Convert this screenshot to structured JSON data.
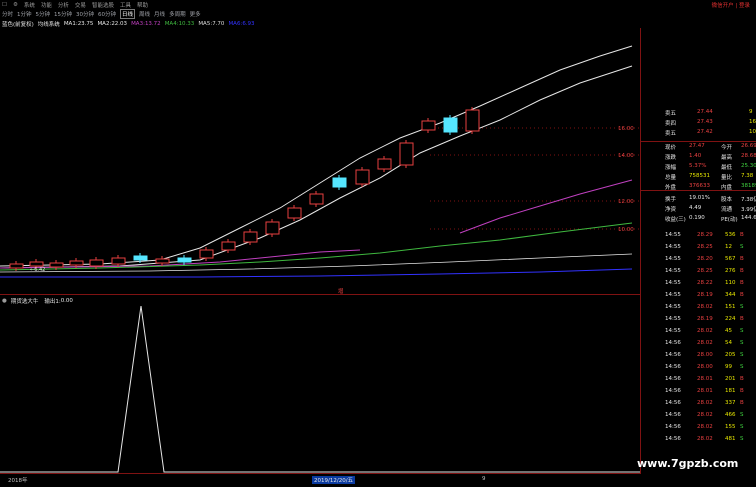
{
  "toolbar": {
    "items": [
      "☐",
      "⚙",
      "系统",
      "功能",
      "分析",
      "交易",
      "智能选股",
      "工具",
      "帮助"
    ],
    "right_text": "微信开户 | 登录"
  },
  "periods": {
    "items": [
      "分时",
      "1分钟",
      "5分钟",
      "15分钟",
      "30分钟",
      "60分钟",
      "日线",
      "周线",
      "月线",
      "多周期",
      "更多"
    ],
    "active": "日线"
  },
  "ma_legend": {
    "title": "蓝色(前复权)",
    "formula": "均线系统",
    "items": [
      {
        "label": "MA1:",
        "value": "23.75",
        "color": "#e6e6e6"
      },
      {
        "label": "MA2:",
        "value": "22.03",
        "color": "#e6e6e6"
      },
      {
        "label": "MA3:",
        "value": "13.72",
        "color": "#c040c0"
      },
      {
        "label": "MA4:",
        "value": "10.33",
        "color": "#3fb83f"
      },
      {
        "label": "MA5:",
        "value": "7.70",
        "color": "#dcdcdc"
      },
      {
        "label": "MA6:",
        "value": "6.93",
        "color": "#3232ff"
      }
    ]
  },
  "price_axis": {
    "labels": [
      "16.00",
      "14.00",
      "12.00",
      "10.00"
    ]
  },
  "chart_annotation": "增",
  "low_label": "←6.42",
  "indicator_legend": {
    "name": "期货选大牛",
    "output_label": "输出1:",
    "output_value": "0.00"
  },
  "quote": {
    "rows": [
      {
        "label": "卖五",
        "value": "27.44",
        "right": "9",
        "vcolor": "#e84040",
        "rcolor": "#e8e800"
      },
      {
        "label": "卖四",
        "value": "27.43",
        "right": "16",
        "vcolor": "#e84040",
        "rcolor": "#e8e800"
      },
      {
        "label": "卖五",
        "value": "27.42",
        "right": "10",
        "vcolor": "#e84040",
        "rcolor": "#e8e800"
      },
      {
        "label": "现价",
        "value": "27.47",
        "mid": "今开",
        "right": "26.69",
        "vcolor": "#e84040",
        "rcolor": "#e84040"
      },
      {
        "label": "涨跌",
        "value": "1.40",
        "mid": "最高",
        "right": "28.68",
        "vcolor": "#e84040",
        "rcolor": "#e84040"
      },
      {
        "label": "涨幅",
        "value": "5.37%",
        "mid": "最低",
        "right": "25.30",
        "vcolor": "#e84040",
        "rcolor": "#3fd03f"
      },
      {
        "label": "总量",
        "value": "758531",
        "mid": "量比",
        "right": "7.38",
        "vcolor": "#e6e600",
        "rcolor": "#e6e600"
      },
      {
        "label": "外盘",
        "value": "376633",
        "mid": "内盘",
        "right": "381898",
        "vcolor": "#e84040",
        "rcolor": "#3fd03f"
      },
      {
        "label": "换手",
        "value": "19.01%",
        "mid": "股本",
        "right": "7.38亿",
        "vcolor": "#e6e6e6",
        "rcolor": "#e6e6e6"
      },
      {
        "label": "净资",
        "value": "4.49",
        "mid": "流通",
        "right": "3.99亿",
        "vcolor": "#e6e6e6",
        "rcolor": "#e6e6e6"
      },
      {
        "label": "收益(三)",
        "value": "0.190",
        "mid": "PE(动)",
        "right": "144.6",
        "vcolor": "#e6e6e6",
        "rcolor": "#e6e6e6"
      }
    ]
  },
  "ticks": [
    {
      "time": "14:55",
      "price": "28.29",
      "vol": "536",
      "dir": "B"
    },
    {
      "time": "14:55",
      "price": "28.25",
      "vol": "12",
      "dir": "S"
    },
    {
      "time": "14:55",
      "price": "28.20",
      "vol": "567",
      "dir": "B"
    },
    {
      "time": "14:55",
      "price": "28.25",
      "vol": "276",
      "dir": "B"
    },
    {
      "time": "14:55",
      "price": "28.22",
      "vol": "110",
      "dir": "B"
    },
    {
      "time": "14:55",
      "price": "28.19",
      "vol": "344",
      "dir": "B"
    },
    {
      "time": "14:55",
      "price": "28.02",
      "vol": "151",
      "dir": "S"
    },
    {
      "time": "14:55",
      "price": "28.19",
      "vol": "224",
      "dir": "B"
    },
    {
      "time": "14:55",
      "price": "28.02",
      "vol": "45",
      "dir": "S"
    },
    {
      "time": "14:56",
      "price": "28.02",
      "vol": "54",
      "dir": "S"
    },
    {
      "time": "14:56",
      "price": "28.00",
      "vol": "205",
      "dir": "S"
    },
    {
      "time": "14:56",
      "price": "28.00",
      "vol": "99",
      "dir": "S"
    },
    {
      "time": "14:56",
      "price": "28.01",
      "vol": "201",
      "dir": "B"
    },
    {
      "time": "14:56",
      "price": "28.01",
      "vol": "181",
      "dir": "B"
    },
    {
      "time": "14:56",
      "price": "28.02",
      "vol": "337",
      "dir": "B"
    },
    {
      "time": "14:56",
      "price": "28.02",
      "vol": "466",
      "dir": "S"
    },
    {
      "time": "14:56",
      "price": "28.02",
      "vol": "155",
      "dir": "S"
    },
    {
      "time": "14:56",
      "price": "28.02",
      "vol": "481",
      "dir": "S"
    }
  ],
  "date_axis": {
    "left": "2018年",
    "center": "2019/12/20/五",
    "right": "9"
  },
  "watermark": "www.7gpzb.com",
  "colors": {
    "up": "#e84040",
    "down": "#3fd03f",
    "doji": "#55e6ff",
    "grid": "#7f1212",
    "ma_white": "#e6e6e6",
    "ma_magenta": "#c040c0",
    "ma_green": "#3fb83f",
    "ma_blue": "#3232ff"
  }
}
